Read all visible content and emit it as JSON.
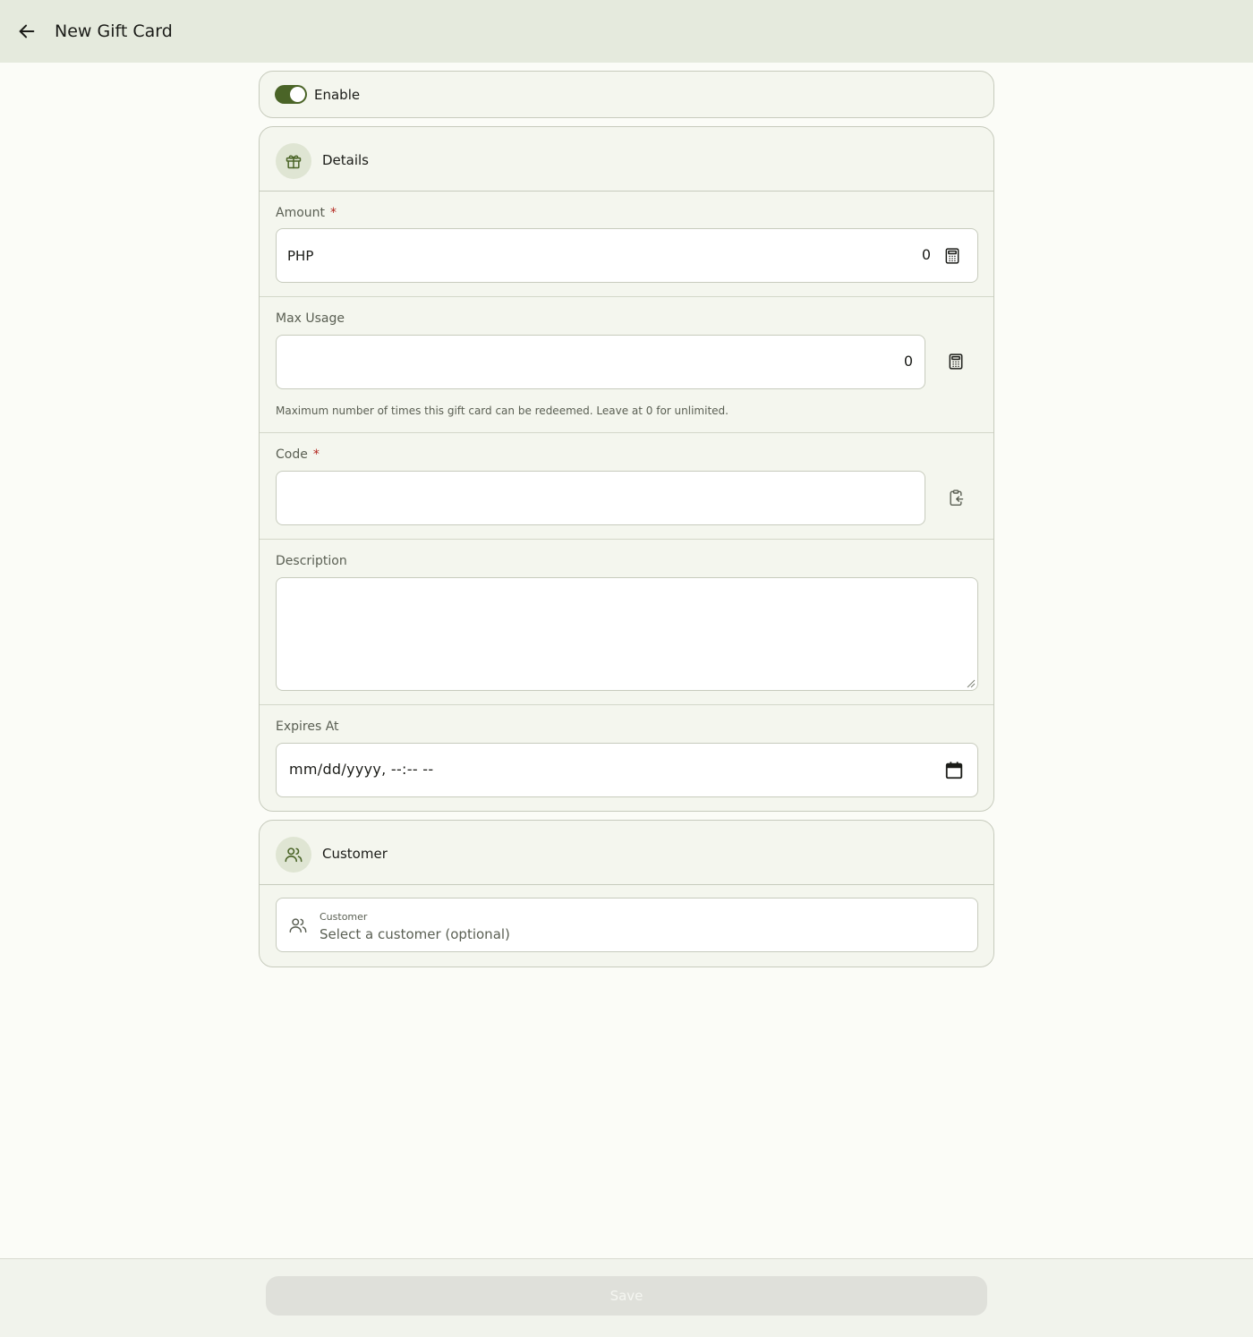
{
  "header": {
    "title": "New Gift Card",
    "back_icon": "arrow-left-icon"
  },
  "enable": {
    "label": "Enable",
    "checked": true,
    "accent": "#4a6427"
  },
  "details": {
    "title": "Details",
    "icon": "gift-icon",
    "amount": {
      "label": "Amount",
      "required_mark": "*",
      "currency": "PHP",
      "value": "0",
      "icon": "calculator-icon"
    },
    "max_usage": {
      "label": "Max Usage",
      "value": "0",
      "icon": "calculator-icon",
      "helper": "Maximum number of times this gift card can be redeemed. Leave at 0 for unlimited."
    },
    "code": {
      "label": "Code",
      "required_mark": "*",
      "value": "",
      "icon": "clipboard-paste-icon"
    },
    "description": {
      "label": "Description",
      "value": ""
    },
    "expires_at": {
      "label": "Expires At",
      "placeholder": "mm/dd/yyyy, --:-- --",
      "icon": "calendar-icon"
    }
  },
  "customer": {
    "title": "Customer",
    "icon": "users-icon",
    "select_label": "Customer",
    "select_placeholder": "Select a customer (optional)"
  },
  "footer": {
    "save_label": "Save"
  }
}
